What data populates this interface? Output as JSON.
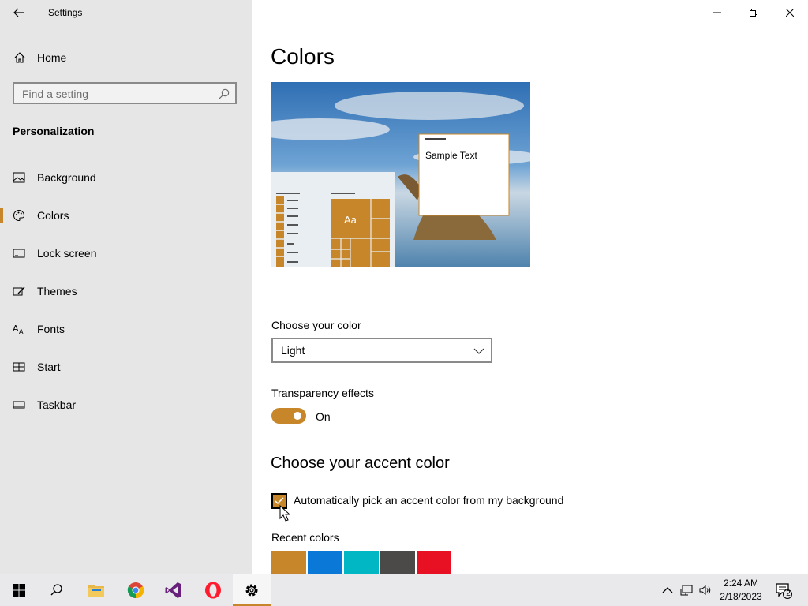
{
  "window": {
    "title": "Settings",
    "icons": {
      "back": "back-arrow-icon",
      "minimize": "minimize-icon",
      "restore": "restore-icon",
      "close": "close-icon"
    }
  },
  "sidebar": {
    "home_label": "Home",
    "search_placeholder": "Find a setting",
    "section_heading": "Personalization",
    "items": [
      {
        "label": "Background",
        "icon": "picture-icon"
      },
      {
        "label": "Colors",
        "icon": "palette-icon",
        "selected": true
      },
      {
        "label": "Lock screen",
        "icon": "lock-screen-icon"
      },
      {
        "label": "Themes",
        "icon": "themes-icon"
      },
      {
        "label": "Fonts",
        "icon": "fonts-icon"
      },
      {
        "label": "Start",
        "icon": "start-icon"
      },
      {
        "label": "Taskbar",
        "icon": "taskbar-icon"
      }
    ]
  },
  "main": {
    "page_title": "Colors",
    "preview": {
      "tile_text": "Aa",
      "sample_text": "Sample Text"
    },
    "choose_color_label": "Choose your color",
    "choose_color_value": "Light",
    "transparency_label": "Transparency effects",
    "transparency_state": "On",
    "accent_heading": "Choose your accent color",
    "auto_accent_label": "Automatically pick an accent color from my background",
    "auto_accent_checked": true,
    "recent_colors_label": "Recent colors",
    "recent_colors": [
      "#c8862a",
      "#0a78d7",
      "#00b7c3",
      "#4c4a48",
      "#e81123"
    ]
  },
  "taskbar": {
    "apps": [
      "start-icon",
      "search-icon",
      "file-explorer-icon",
      "chrome-icon",
      "visual-studio-icon",
      "opera-icon",
      "settings-gear-icon"
    ],
    "time": "2:24 AM",
    "date": "2/18/2023",
    "notification_count": "2"
  },
  "colors": {
    "accent": "#c8862a",
    "sidebar_bg": "#e6e6e6",
    "taskbar_bg": "#e9e9ec"
  }
}
